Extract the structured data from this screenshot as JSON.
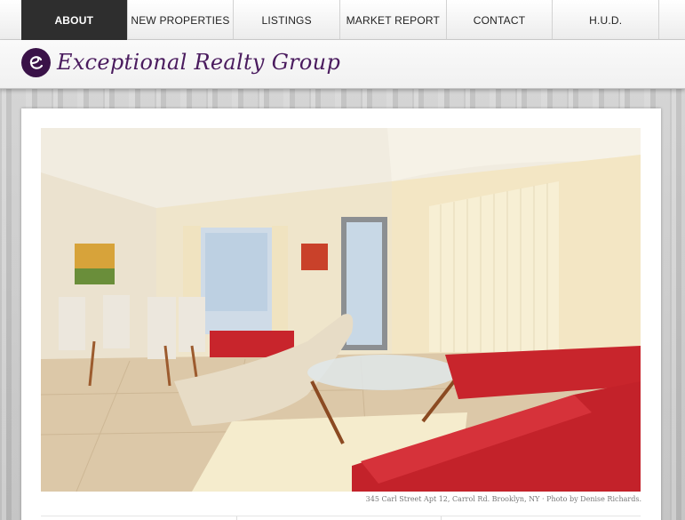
{
  "nav": {
    "items": [
      {
        "label": "ABOUT",
        "active": true
      },
      {
        "label": "NEW PROPERTIES",
        "active": false
      },
      {
        "label": "LISTINGS",
        "active": false
      },
      {
        "label": "MARKET REPORT",
        "active": false
      },
      {
        "label": "CONTACT",
        "active": false
      },
      {
        "label": "H.U.D.",
        "active": false
      }
    ]
  },
  "brand": {
    "name": "Exceptional Realty Group",
    "logo_letter": "e",
    "color": "#4a1b5e"
  },
  "photo": {
    "caption": "345 Carl Street Apt 12, Carrol Rd. Brooklyn, NY · Photo by Denise Richards."
  },
  "colors": {
    "active_nav_bg": "#2e2e2e",
    "sofa_red": "#c8252c",
    "wall_cream": "#efe6cc"
  }
}
